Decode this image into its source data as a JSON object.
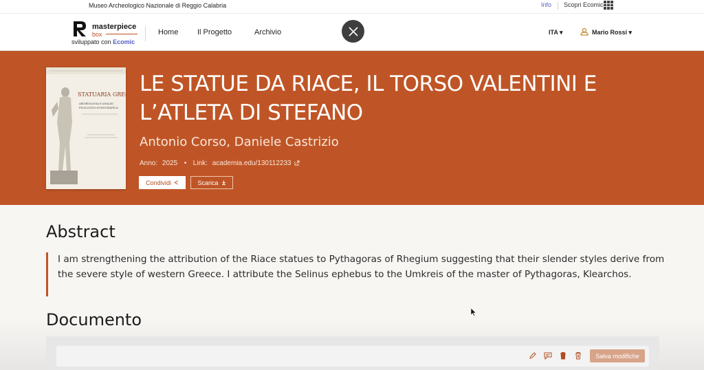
{
  "topbar": {
    "museum": "Museo Archeologico Nazionale di Reggio Calabria",
    "info": "Info",
    "discover": "Scopri Ecomic"
  },
  "logo": {
    "word1": "masterpiece",
    "word2": "box",
    "sub_prefix": "sviluppato con",
    "sub_brand": "Ecomic"
  },
  "nav": {
    "items": [
      {
        "label": "Home"
      },
      {
        "label": "Il Progetto"
      },
      {
        "label": "Archivio"
      }
    ],
    "language": "ITA ▾",
    "user": "Mario Rossi ▾"
  },
  "hero": {
    "title": "LE STATUE DA RIACE, IL TORSO VALENTINI E L’ATLETA DI STEFANO",
    "authors": "Antonio Corso, Daniele Castrizio",
    "year_label": "Anno:",
    "year": "2025",
    "link_label": "Link:",
    "link": "academia.edu/130112233",
    "share_label": "Condividi",
    "download_label": "Scarica",
    "cover_title": "STATUARIA GRECA",
    "cover_sub1": "ARCHEOLOGIA E ANALISI",
    "cover_sub2": "FILOLOGICO-ICONOGRAFICA"
  },
  "abstract": {
    "heading": "Abstract",
    "text": "I am strengthening the attribution of the Riace statues to Pythagoras of Rhegium suggesting that their slender styles derive from the severe style of western Greece. I attribute the Selinus ephebus to the Umkreis of the master of Pythagoras, Klearchos."
  },
  "document": {
    "heading": "Documento",
    "save_label": "Salva modifiche"
  },
  "colors": {
    "accent": "#bf5526",
    "link": "#5561c4"
  }
}
